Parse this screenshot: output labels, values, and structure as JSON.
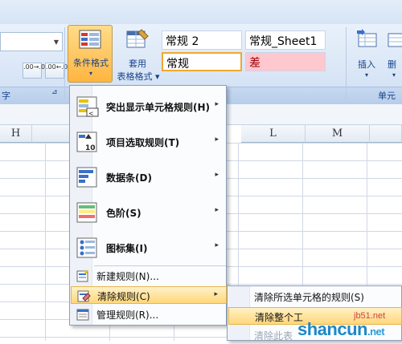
{
  "ribbon": {
    "font_group_label": "字",
    "number_format_buttons": [
      ".00→.0",
      ".00←.0"
    ],
    "conditional_format": {
      "label": "条件格式",
      "chevron": "▾"
    },
    "table_format": {
      "line1": "套用",
      "line2": "表格格式",
      "chevron": "▾"
    },
    "styles": {
      "normal2": "常规 2",
      "normal_sheet1": "常规_Sheet1",
      "normal": "常规",
      "bad": "差"
    },
    "insert": {
      "label": "插入",
      "chevron": "▾"
    },
    "delete": {
      "label": "删",
      "chevron": "▾"
    },
    "cells_group_label": "单元",
    "colors": {
      "selected_button": "#ffc55a",
      "bad_bg": "#ffc7ce",
      "bad_text": "#9c0006",
      "normal_border": "#f0a830"
    }
  },
  "columns": [
    "H",
    "L",
    "M"
  ],
  "menu": {
    "big_items": [
      {
        "label": "突出显示单元格规则(H)",
        "icon": "highlight-cells-icon"
      },
      {
        "label": "项目选取规则(T)",
        "icon": "top-bottom-icon"
      },
      {
        "label": "数据条(D)",
        "icon": "data-bars-icon"
      },
      {
        "label": "色阶(S)",
        "icon": "color-scales-icon"
      },
      {
        "label": "图标集(I)",
        "icon": "icon-sets-icon"
      }
    ],
    "small_items": [
      {
        "label": "新建规则(N)...",
        "icon": "new-rule-icon"
      },
      {
        "label": "清除规则(C)",
        "icon": "clear-rules-icon"
      },
      {
        "label": "管理规则(R)...",
        "icon": "manage-rules-icon"
      }
    ],
    "arrow": "▸"
  },
  "submenu": {
    "items": [
      {
        "label": "清除所选单元格的规则(S)"
      },
      {
        "label": "清除整个工"
      },
      {
        "label": "清除此表"
      }
    ]
  },
  "watermark": {
    "site": "jb51.net",
    "brand": "shancun",
    "suffix": ".net"
  }
}
